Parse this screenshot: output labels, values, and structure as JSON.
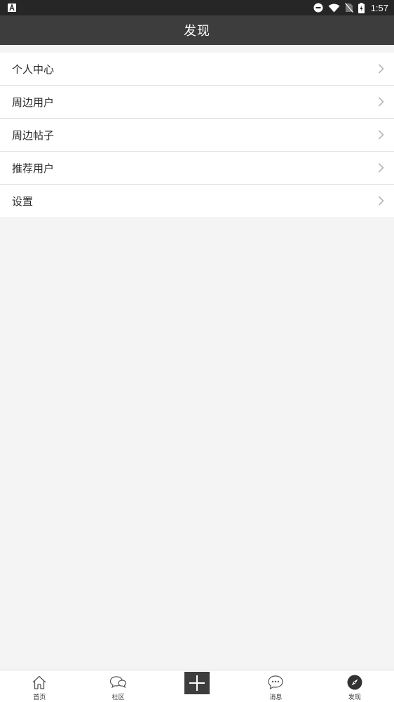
{
  "status_bar": {
    "time": "1:57",
    "icons": [
      "app-a-icon",
      "do-not-disturb-icon",
      "wifi-icon",
      "no-sim-icon",
      "battery-charging-icon"
    ]
  },
  "header": {
    "title": "发现"
  },
  "menu": {
    "items": [
      {
        "label": "个人中心",
        "icon": "chevron-right-icon"
      },
      {
        "label": "周边用户",
        "icon": "chevron-right-icon"
      },
      {
        "label": "周边帖子",
        "icon": "chevron-right-icon"
      },
      {
        "label": "推荐用户",
        "icon": "chevron-right-icon"
      },
      {
        "label": "设置",
        "icon": "chevron-right-icon"
      }
    ]
  },
  "tab_bar": {
    "tabs": [
      {
        "label": "首页",
        "icon": "home-icon",
        "active": false
      },
      {
        "label": "社区",
        "icon": "community-chat-icon",
        "active": false
      },
      {
        "label": "",
        "icon": "plus-icon",
        "active": false
      },
      {
        "label": "消息",
        "icon": "message-icon",
        "active": false
      },
      {
        "label": "发现",
        "icon": "compass-icon",
        "active": true
      }
    ]
  }
}
